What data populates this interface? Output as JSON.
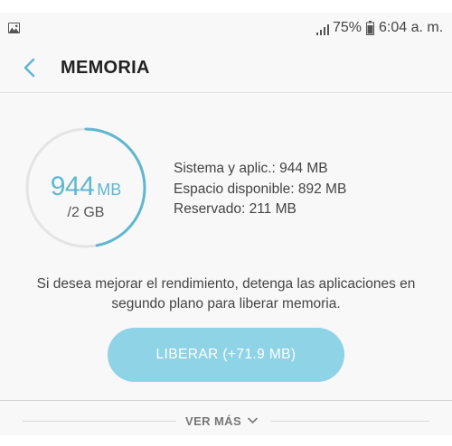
{
  "status_bar": {
    "battery_percent": "75%",
    "time": "6:04 a. m.",
    "icons": [
      "image-notification-icon",
      "signal-icon",
      "battery-icon"
    ]
  },
  "header": {
    "title": "MEMORIA",
    "back_icon": "chevron-left-icon"
  },
  "memory": {
    "used_value": "944",
    "used_unit": "MB",
    "total": "/2 GB",
    "used_fraction": 0.47,
    "details": [
      "Sistema y aplic.: 944 MB",
      "Espacio disponible: 892 MB",
      "Reservado: 211 MB"
    ]
  },
  "description": "Si desea mejorar el rendimiento, detenga las aplicaciones en segundo plano para liberar memoria.",
  "free_button": {
    "label": "LIBERAR (+71.9 MB)"
  },
  "see_more": {
    "label": "VER MÁS",
    "icon": "chevron-down-icon"
  },
  "colors": {
    "accent": "#5fb7cf",
    "button_bg": "#8fd3e6",
    "ring_track": "#e4e4e4",
    "background": "#f8f8f8"
  }
}
